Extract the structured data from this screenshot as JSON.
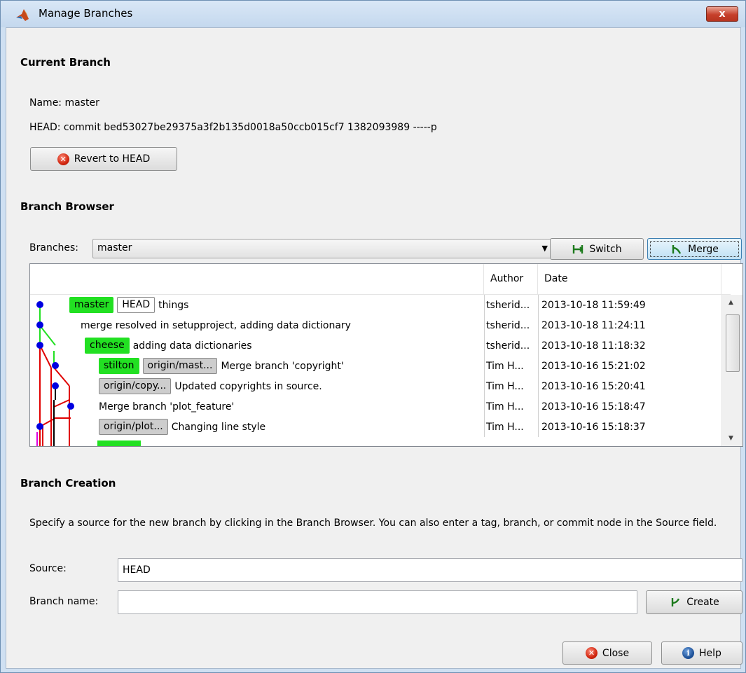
{
  "window": {
    "title": "Manage Branches",
    "close_glyph": "x"
  },
  "current_branch": {
    "heading": "Current Branch",
    "name_line": "Name: master",
    "head_line": "HEAD: commit bed53027be29375a3f2b135d0018a50ccb015cf7 1382093989 -----p",
    "revert_label": "Revert to HEAD"
  },
  "branch_browser": {
    "heading": "Branch Browser",
    "branches_label": "Branches:",
    "selected_branch": "master",
    "switch_label": "Switch",
    "merge_label": "Merge",
    "columns": {
      "message": "",
      "author": "Author",
      "date": "Date"
    },
    "rows": [
      {
        "tags": [
          {
            "text": "master",
            "style": "green"
          },
          {
            "text": "HEAD",
            "style": "white"
          }
        ],
        "message": "things",
        "author": "tsherid...",
        "date": "2013-10-18 11:59:49"
      },
      {
        "tags": [],
        "message": "merge resolved in setupproject, adding data dictionary",
        "author": "tsherid...",
        "date": "2013-10-18 11:24:11"
      },
      {
        "tags": [
          {
            "text": "cheese",
            "style": "green"
          }
        ],
        "message": "adding data dictionaries",
        "author": "tsherid...",
        "date": "2013-10-18 11:18:32"
      },
      {
        "tags": [
          {
            "text": "stilton",
            "style": "green"
          },
          {
            "text": "origin/mast...",
            "style": "gray"
          }
        ],
        "message": "Merge branch 'copyright'",
        "author": "Tim H...",
        "date": "2013-10-16 15:21:02"
      },
      {
        "tags": [
          {
            "text": "origin/copy...",
            "style": "gray"
          }
        ],
        "message": "Updated copyrights in source.",
        "author": "Tim H...",
        "date": "2013-10-16 15:20:41"
      },
      {
        "tags": [],
        "message": "Merge branch 'plot_feature'",
        "author": "Tim H...",
        "date": "2013-10-16 15:18:47"
      },
      {
        "tags": [
          {
            "text": "origin/plot...",
            "style": "gray"
          }
        ],
        "message": "Changing line style",
        "author": "Tim H...",
        "date": "2013-10-16 15:18:37"
      }
    ],
    "colors": {
      "node": "#0000e0",
      "line_red": "#e00000",
      "line_green": "#22e022",
      "line_black": "#000000",
      "line_magenta": "#e000e0"
    }
  },
  "branch_creation": {
    "heading": "Branch Creation",
    "description": "Specify a source for the new branch by clicking in the Branch Browser. You can also enter a tag, branch, or commit node in the Source field.",
    "source_label": "Source:",
    "source_value": "HEAD",
    "branch_name_label": "Branch name:",
    "branch_name_value": "",
    "create_label": "Create"
  },
  "footer": {
    "close_label": "Close",
    "help_label": "Help"
  }
}
